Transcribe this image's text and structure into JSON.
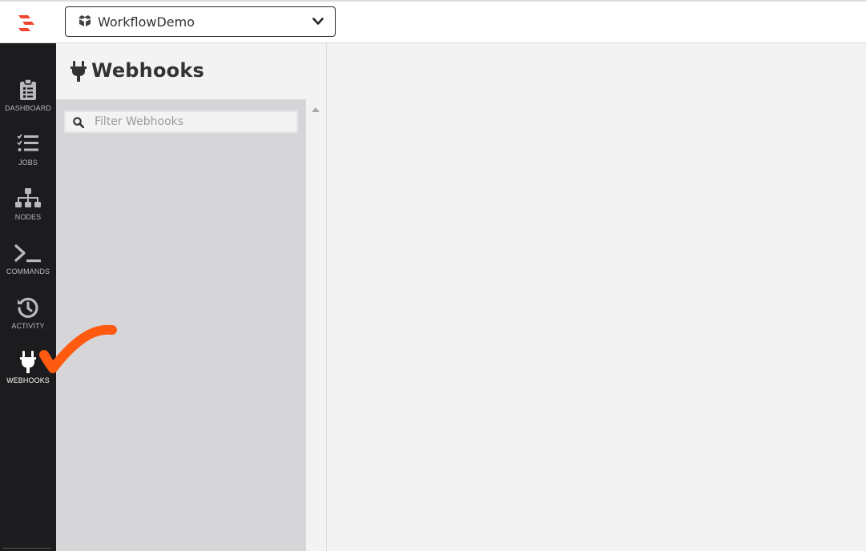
{
  "topbar": {
    "logo_icon": "rundeck-logo-icon",
    "project": {
      "name": "WorkflowDemo",
      "icon": "cubes-icon",
      "dropdown_icon": "chevron-down-icon"
    }
  },
  "sidenav": {
    "items": [
      {
        "id": "dashboard",
        "label": "DASHBOARD",
        "icon": "clipboard-icon",
        "active": false
      },
      {
        "id": "jobs",
        "label": "JOBS",
        "icon": "tasks-icon",
        "active": false
      },
      {
        "id": "nodes",
        "label": "NODES",
        "icon": "sitemap-icon",
        "active": false
      },
      {
        "id": "commands",
        "label": "COMMANDS",
        "icon": "terminal-icon",
        "active": false
      },
      {
        "id": "activity",
        "label": "ACTIVITY",
        "icon": "history-icon",
        "active": false
      },
      {
        "id": "webhooks",
        "label": "WEBHOOKS",
        "icon": "plug-icon",
        "active": true
      }
    ]
  },
  "panel": {
    "title": "Webhooks",
    "title_icon": "plug-icon",
    "filter": {
      "placeholder": "Filter Webhooks",
      "value": ""
    }
  },
  "colors": {
    "brand": "#f0452e",
    "sidebar_bg": "#1c1c1e",
    "annotation": "#ff5a10"
  }
}
